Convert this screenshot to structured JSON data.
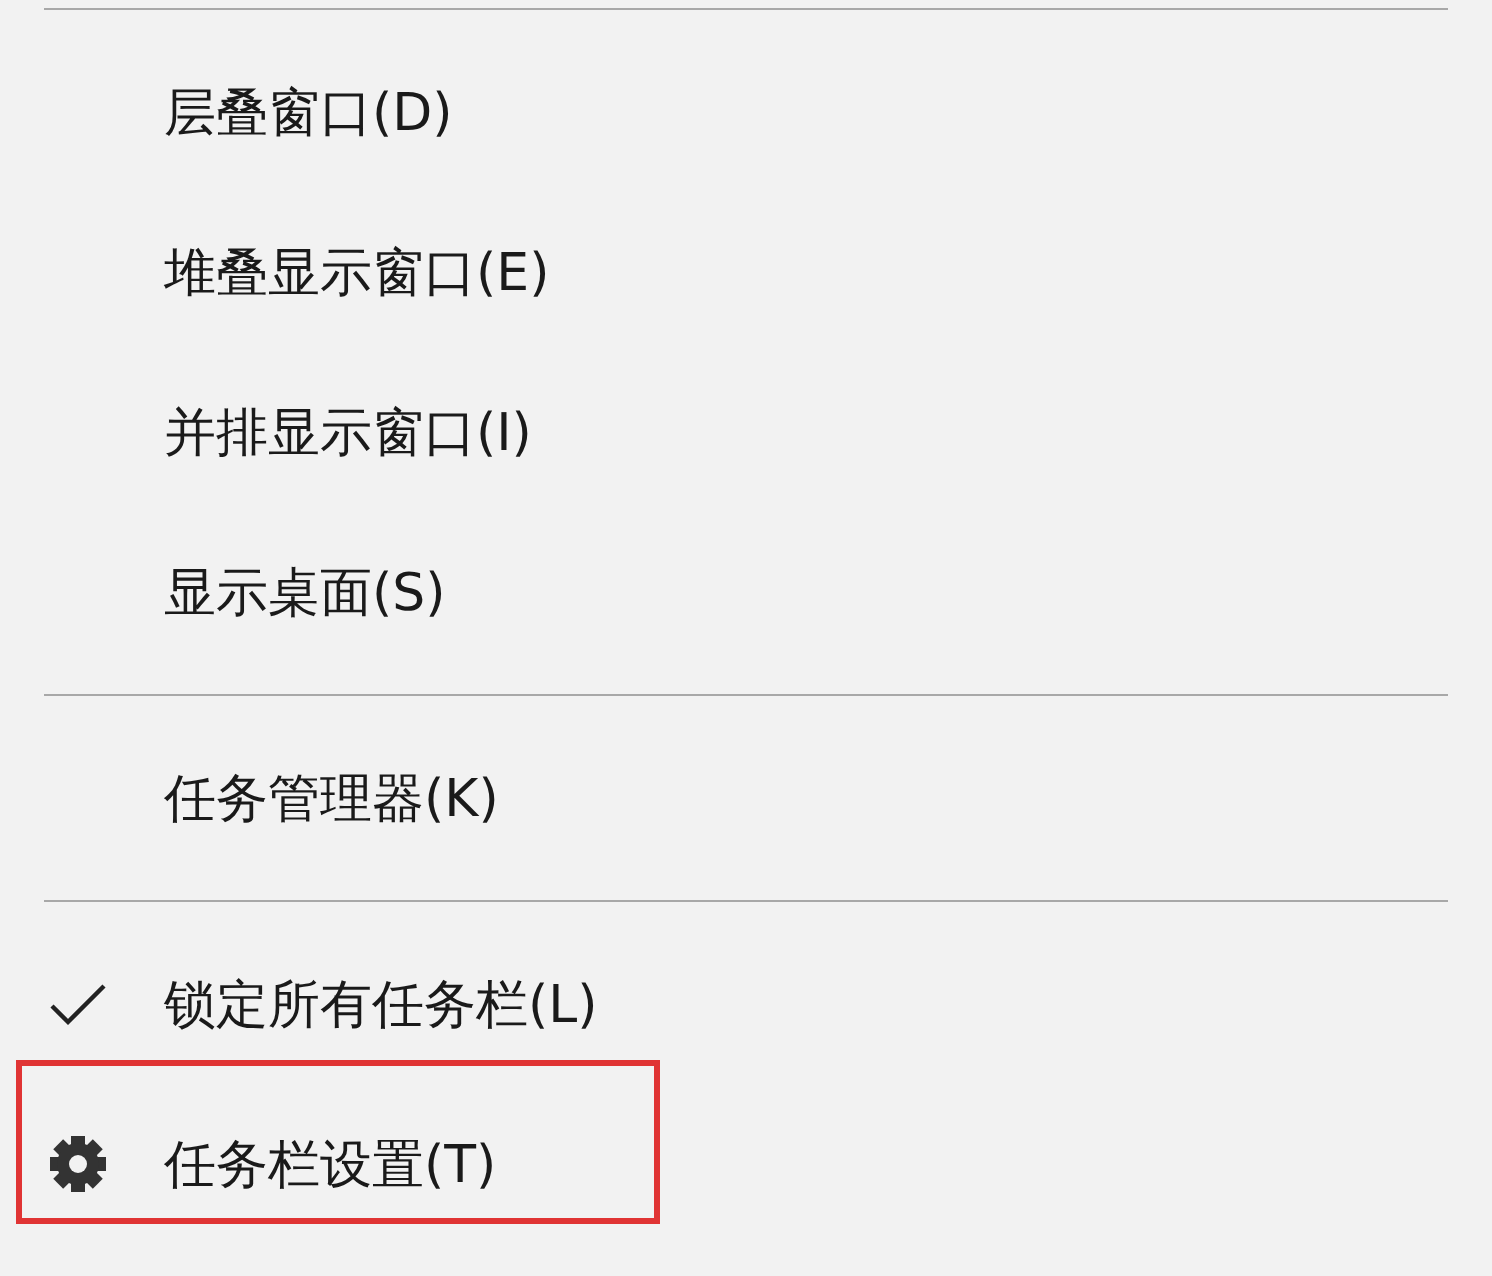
{
  "menu": {
    "items": [
      {
        "kind": "separator"
      },
      {
        "kind": "command",
        "label": "层叠窗口(D)"
      },
      {
        "kind": "command",
        "label": "堆叠显示窗口(E)"
      },
      {
        "kind": "command",
        "label": "并排显示窗口(I)"
      },
      {
        "kind": "command",
        "label": "显示桌面(S)"
      },
      {
        "kind": "separator"
      },
      {
        "kind": "command",
        "label": "任务管理器(K)"
      },
      {
        "kind": "separator"
      },
      {
        "kind": "toggle",
        "label": "锁定所有任务栏(L)",
        "checked": true
      },
      {
        "kind": "settings",
        "label": "任务栏设置(T)",
        "highlighted": true
      }
    ]
  }
}
